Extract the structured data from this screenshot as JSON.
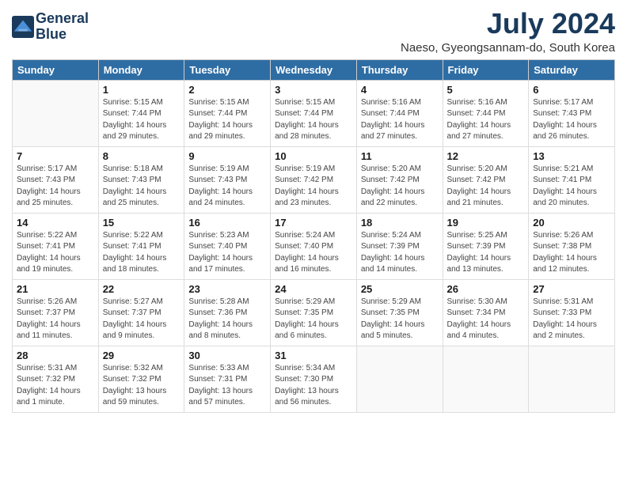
{
  "header": {
    "logo_line1": "General",
    "logo_line2": "Blue",
    "month_year": "July 2024",
    "location": "Naeso, Gyeongsannam-do, South Korea"
  },
  "weekdays": [
    "Sunday",
    "Monday",
    "Tuesday",
    "Wednesday",
    "Thursday",
    "Friday",
    "Saturday"
  ],
  "weeks": [
    [
      {
        "day": "",
        "info": ""
      },
      {
        "day": "1",
        "info": "Sunrise: 5:15 AM\nSunset: 7:44 PM\nDaylight: 14 hours\nand 29 minutes."
      },
      {
        "day": "2",
        "info": "Sunrise: 5:15 AM\nSunset: 7:44 PM\nDaylight: 14 hours\nand 29 minutes."
      },
      {
        "day": "3",
        "info": "Sunrise: 5:15 AM\nSunset: 7:44 PM\nDaylight: 14 hours\nand 28 minutes."
      },
      {
        "day": "4",
        "info": "Sunrise: 5:16 AM\nSunset: 7:44 PM\nDaylight: 14 hours\nand 27 minutes."
      },
      {
        "day": "5",
        "info": "Sunrise: 5:16 AM\nSunset: 7:44 PM\nDaylight: 14 hours\nand 27 minutes."
      },
      {
        "day": "6",
        "info": "Sunrise: 5:17 AM\nSunset: 7:43 PM\nDaylight: 14 hours\nand 26 minutes."
      }
    ],
    [
      {
        "day": "7",
        "info": "Sunrise: 5:17 AM\nSunset: 7:43 PM\nDaylight: 14 hours\nand 25 minutes."
      },
      {
        "day": "8",
        "info": "Sunrise: 5:18 AM\nSunset: 7:43 PM\nDaylight: 14 hours\nand 25 minutes."
      },
      {
        "day": "9",
        "info": "Sunrise: 5:19 AM\nSunset: 7:43 PM\nDaylight: 14 hours\nand 24 minutes."
      },
      {
        "day": "10",
        "info": "Sunrise: 5:19 AM\nSunset: 7:42 PM\nDaylight: 14 hours\nand 23 minutes."
      },
      {
        "day": "11",
        "info": "Sunrise: 5:20 AM\nSunset: 7:42 PM\nDaylight: 14 hours\nand 22 minutes."
      },
      {
        "day": "12",
        "info": "Sunrise: 5:20 AM\nSunset: 7:42 PM\nDaylight: 14 hours\nand 21 minutes."
      },
      {
        "day": "13",
        "info": "Sunrise: 5:21 AM\nSunset: 7:41 PM\nDaylight: 14 hours\nand 20 minutes."
      }
    ],
    [
      {
        "day": "14",
        "info": "Sunrise: 5:22 AM\nSunset: 7:41 PM\nDaylight: 14 hours\nand 19 minutes."
      },
      {
        "day": "15",
        "info": "Sunrise: 5:22 AM\nSunset: 7:41 PM\nDaylight: 14 hours\nand 18 minutes."
      },
      {
        "day": "16",
        "info": "Sunrise: 5:23 AM\nSunset: 7:40 PM\nDaylight: 14 hours\nand 17 minutes."
      },
      {
        "day": "17",
        "info": "Sunrise: 5:24 AM\nSunset: 7:40 PM\nDaylight: 14 hours\nand 16 minutes."
      },
      {
        "day": "18",
        "info": "Sunrise: 5:24 AM\nSunset: 7:39 PM\nDaylight: 14 hours\nand 14 minutes."
      },
      {
        "day": "19",
        "info": "Sunrise: 5:25 AM\nSunset: 7:39 PM\nDaylight: 14 hours\nand 13 minutes."
      },
      {
        "day": "20",
        "info": "Sunrise: 5:26 AM\nSunset: 7:38 PM\nDaylight: 14 hours\nand 12 minutes."
      }
    ],
    [
      {
        "day": "21",
        "info": "Sunrise: 5:26 AM\nSunset: 7:37 PM\nDaylight: 14 hours\nand 11 minutes."
      },
      {
        "day": "22",
        "info": "Sunrise: 5:27 AM\nSunset: 7:37 PM\nDaylight: 14 hours\nand 9 minutes."
      },
      {
        "day": "23",
        "info": "Sunrise: 5:28 AM\nSunset: 7:36 PM\nDaylight: 14 hours\nand 8 minutes."
      },
      {
        "day": "24",
        "info": "Sunrise: 5:29 AM\nSunset: 7:35 PM\nDaylight: 14 hours\nand 6 minutes."
      },
      {
        "day": "25",
        "info": "Sunrise: 5:29 AM\nSunset: 7:35 PM\nDaylight: 14 hours\nand 5 minutes."
      },
      {
        "day": "26",
        "info": "Sunrise: 5:30 AM\nSunset: 7:34 PM\nDaylight: 14 hours\nand 4 minutes."
      },
      {
        "day": "27",
        "info": "Sunrise: 5:31 AM\nSunset: 7:33 PM\nDaylight: 14 hours\nand 2 minutes."
      }
    ],
    [
      {
        "day": "28",
        "info": "Sunrise: 5:31 AM\nSunset: 7:32 PM\nDaylight: 14 hours\nand 1 minute."
      },
      {
        "day": "29",
        "info": "Sunrise: 5:32 AM\nSunset: 7:32 PM\nDaylight: 13 hours\nand 59 minutes."
      },
      {
        "day": "30",
        "info": "Sunrise: 5:33 AM\nSunset: 7:31 PM\nDaylight: 13 hours\nand 57 minutes."
      },
      {
        "day": "31",
        "info": "Sunrise: 5:34 AM\nSunset: 7:30 PM\nDaylight: 13 hours\nand 56 minutes."
      },
      {
        "day": "",
        "info": ""
      },
      {
        "day": "",
        "info": ""
      },
      {
        "day": "",
        "info": ""
      }
    ]
  ]
}
